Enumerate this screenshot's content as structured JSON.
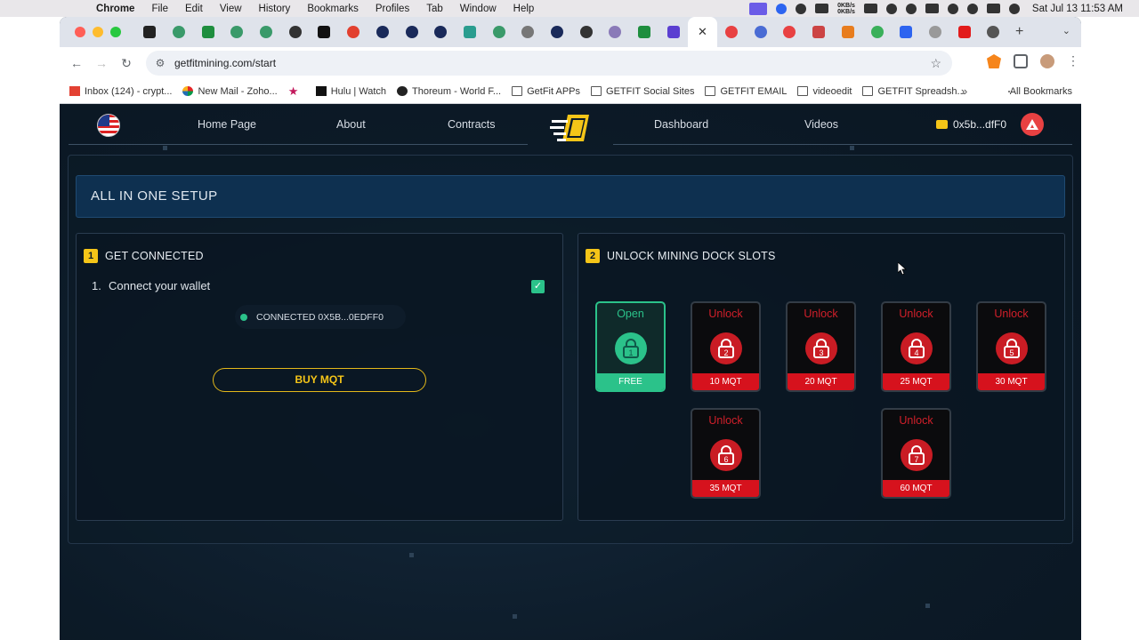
{
  "menubar": {
    "app": "Chrome",
    "items": [
      "File",
      "Edit",
      "View",
      "History",
      "Bookmarks",
      "Profiles",
      "Tab",
      "Window",
      "Help"
    ],
    "net_up": "0KB/s",
    "net_down": "0KB/s",
    "clock": "Sat Jul 13  11:53 AM"
  },
  "toolbar": {
    "url": "getfitmining.com/start"
  },
  "bookmarks": [
    {
      "label": "Inbox (124) - crypt...",
      "icon": "gmail-icon"
    },
    {
      "label": "New Mail - Zoho...",
      "icon": "zoho-icon"
    },
    {
      "label": "",
      "icon": "star-icon"
    },
    {
      "label": "Hulu | Watch",
      "icon": "hulu-icon"
    },
    {
      "label": "Thoreum - World F...",
      "icon": "thoreum-icon"
    },
    {
      "label": "GetFit APPs",
      "icon": "folder-icon"
    },
    {
      "label": "GETFIT Social Sites",
      "icon": "folder-icon"
    },
    {
      "label": "GETFIT EMAIL",
      "icon": "folder-icon"
    },
    {
      "label": "videoedit",
      "icon": "folder-icon"
    },
    {
      "label": "GETFIT Spreadsh...",
      "icon": "folder-icon"
    }
  ],
  "bookmarks_all": "All Bookmarks",
  "nav": {
    "home": "Home Page",
    "about": "About",
    "contracts": "Contracts",
    "dashboard": "Dashboard",
    "videos": "Videos",
    "wallet": "0x5b...dfF0"
  },
  "setup": {
    "title": "ALL IN ONE SETUP"
  },
  "connect": {
    "step": "1",
    "title": "GET CONNECTED",
    "item_num": "1.",
    "item_text": "Connect your wallet",
    "check": "✓",
    "status": "CONNECTED 0X5B...0EDFF0",
    "buy_label": "BUY MQT"
  },
  "unlock": {
    "step": "2",
    "title": "UNLOCK MINING DOCK SLOTS",
    "slots": [
      {
        "label": "Open",
        "num": "1",
        "price": "FREE",
        "open": true
      },
      {
        "label": "Unlock",
        "num": "2",
        "price": "10 MQT",
        "open": false
      },
      {
        "label": "Unlock",
        "num": "3",
        "price": "20 MQT",
        "open": false
      },
      {
        "label": "Unlock",
        "num": "4",
        "price": "25 MQT",
        "open": false
      },
      {
        "label": "Unlock",
        "num": "5",
        "price": "30 MQT",
        "open": false
      },
      {
        "label": "Unlock",
        "num": "6",
        "price": "35 MQT",
        "open": false
      },
      {
        "label": "Unlock",
        "num": "7",
        "price": "60 MQT",
        "open": false
      }
    ]
  },
  "colors": {
    "accent_yellow": "#f5c518",
    "open_green": "#2bc28a",
    "locked_red": "#d6121d",
    "page_bg": "#0c1a27"
  }
}
